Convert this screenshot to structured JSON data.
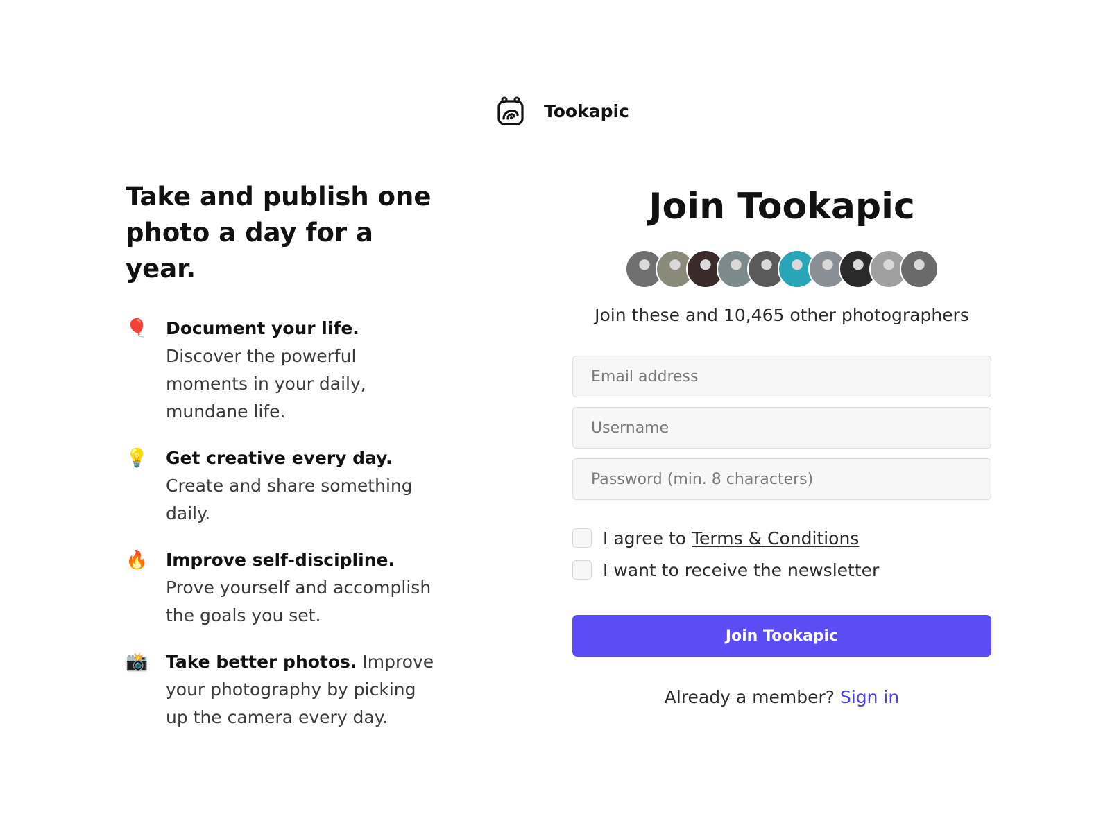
{
  "brand": {
    "name": "Tookapic",
    "logo_icon": "camera-logo-icon"
  },
  "left": {
    "tagline": "Take and publish one photo a day for a year.",
    "features": [
      {
        "icon": "balloon-icon",
        "glyph": "🎈",
        "title": "Document your life.",
        "body": " Discover the powerful moments in your daily, mundane life."
      },
      {
        "icon": "lightbulb-icon",
        "glyph": "💡",
        "title": "Get creative every day.",
        "body": " Create and share something daily."
      },
      {
        "icon": "fire-icon",
        "glyph": "🔥",
        "title": "Improve self-discipline.",
        "body": " Prove yourself and accomplish the goals you set."
      },
      {
        "icon": "camera-flash-icon",
        "glyph": "📸",
        "title": "Take better photos.",
        "body": " Improve your photography by picking up the camera every day."
      }
    ]
  },
  "right": {
    "heading": "Join Tookapic",
    "avatar_colors": [
      "#6f6f6f",
      "#8a8a7a",
      "#3a2a2a",
      "#7d8a8c",
      "#5a5a5a",
      "#29a5b8",
      "#8a8f96",
      "#2a2a2a",
      "#a0a0a0",
      "#6a6a6a"
    ],
    "count_text": "Join these and 10,465 other photographers",
    "email_placeholder": "Email address",
    "username_placeholder": "Username",
    "password_placeholder": "Password (min. 8 characters)",
    "agree_prefix": "I agree to ",
    "terms_link": "Terms & Conditions",
    "newsletter_label": "I want to receive the newsletter",
    "submit_label": "Join Tookapic",
    "already_member": "Already a member? ",
    "signin_link": "Sign in"
  },
  "colors": {
    "accent": "#5b4cf5",
    "link": "#4a41e8"
  }
}
